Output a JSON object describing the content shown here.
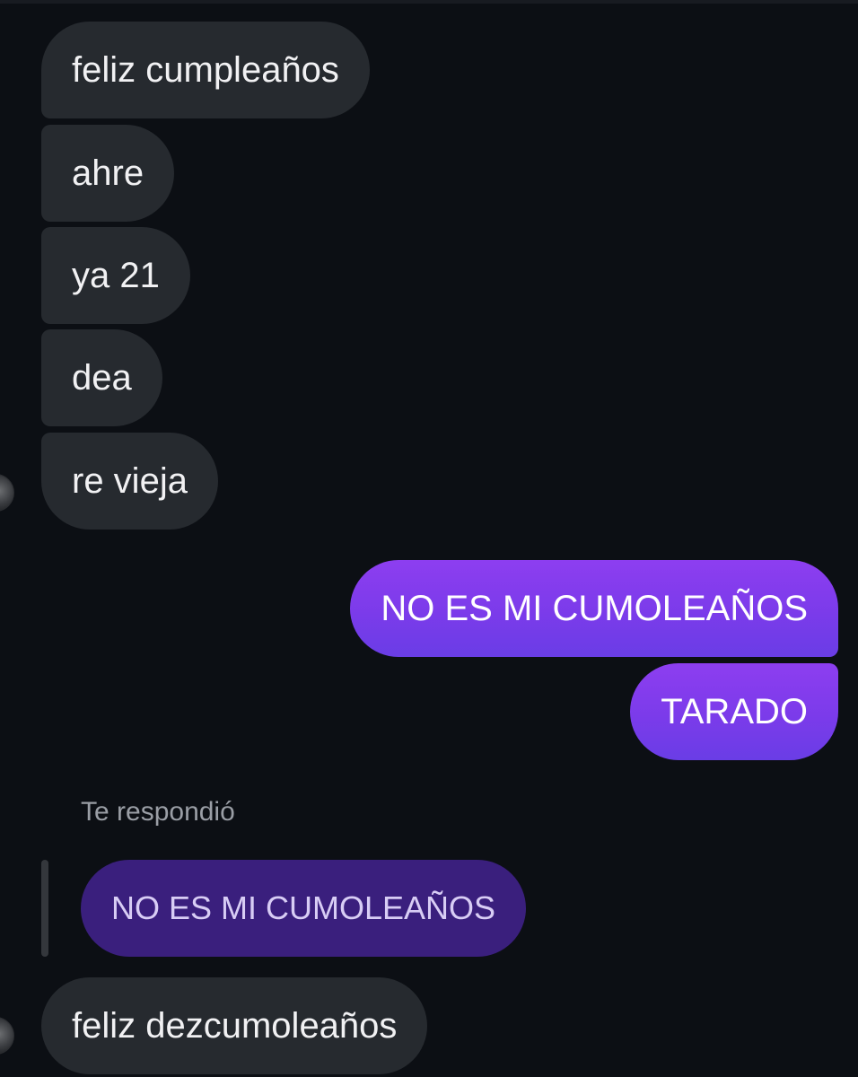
{
  "conversation": {
    "incoming_group_1": [
      {
        "text": "feliz cumpleaños"
      },
      {
        "text": "ahre"
      },
      {
        "text": "ya 21"
      },
      {
        "text": "dea"
      },
      {
        "text": "re vieja"
      }
    ],
    "outgoing_group": [
      {
        "text": "NO ES MI CUMOLEAÑOS"
      },
      {
        "text": "TARADO"
      }
    ],
    "reply": {
      "label": "Te respondió",
      "quoted_text": "NO ES MI CUMOLEAÑOS",
      "message": "feliz dezcumoleaños"
    }
  },
  "colors": {
    "background": "#0c0f14",
    "incoming_bubble": "#262a2f",
    "outgoing_bubble": "#7b3bea",
    "quoted_bubble": "#3a1f7d"
  },
  "icons": {
    "sender_avatar": "avatar"
  }
}
